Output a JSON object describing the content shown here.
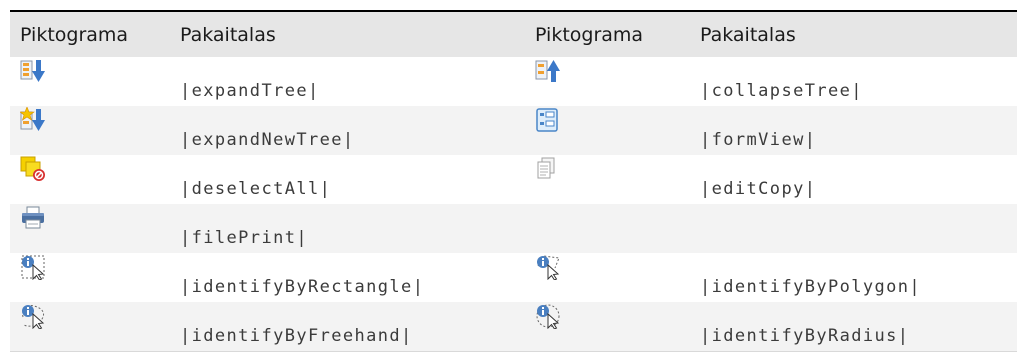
{
  "table": {
    "headers": [
      "Piktograma",
      "Pakaitalas",
      "Piktograma",
      "Pakaitalas"
    ],
    "rows": [
      {
        "left": {
          "icon": "expand-tree-icon",
          "sub": "|expandTree|"
        },
        "right": {
          "icon": "collapse-tree-icon",
          "sub": "|collapseTree|"
        }
      },
      {
        "left": {
          "icon": "expand-new-tree-icon",
          "sub": "|expandNewTree|"
        },
        "right": {
          "icon": "form-view-icon",
          "sub": "|formView|"
        }
      },
      {
        "left": {
          "icon": "deselect-all-icon",
          "sub": "|deselectAll|"
        },
        "right": {
          "icon": "edit-copy-icon",
          "sub": "|editCopy|"
        }
      },
      {
        "left": {
          "icon": "file-print-icon",
          "sub": "|filePrint|"
        },
        "right": {
          "icon": "",
          "sub": ""
        }
      },
      {
        "left": {
          "icon": "identify-by-rectangle-icon",
          "sub": "|identifyByRectangle|"
        },
        "right": {
          "icon": "identify-by-polygon-icon",
          "sub": "|identifyByPolygon|"
        }
      },
      {
        "left": {
          "icon": "identify-by-freehand-icon",
          "sub": "|identifyByFreehand|"
        },
        "right": {
          "icon": "identify-by-radius-icon",
          "sub": "|identifyByRadius|"
        }
      }
    ]
  }
}
